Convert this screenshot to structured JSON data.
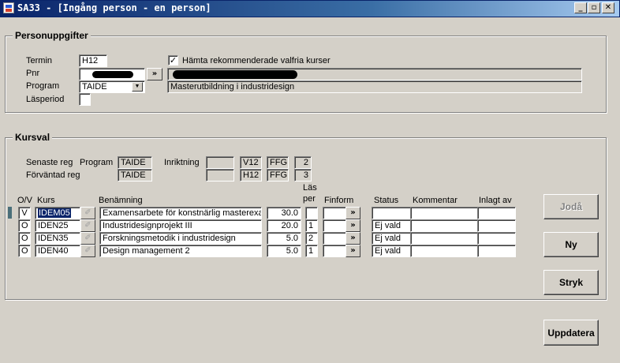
{
  "window": {
    "title": "SA33 - [Ingång person - en person]",
    "minimize_glyph": "_",
    "restore_glyph": "▫",
    "close_glyph": "✕"
  },
  "person": {
    "group_label": "Personuppgifter",
    "termin_label": "Termin",
    "termin_value": "H12",
    "pnr_label": "Pnr",
    "program_label": "Program",
    "program_value": "TAIDE",
    "lasperiod_label": "Läsperiod",
    "lasperiod_value": "",
    "checkbox_checked": true,
    "checkbox_label": "Hämta rekommenderade valfria kurser",
    "program_name": "Masterutbildning i industridesign",
    "arrow_glyph": "»"
  },
  "kursval": {
    "group_label": "Kursval",
    "senaste_label": "Senaste reg",
    "forvantad_label": "Förväntad reg",
    "program_label": "Program",
    "inriktning_label": "Inriktning",
    "senaste": {
      "program": "TAIDE",
      "inriktning": "",
      "termin": "V12",
      "typ": "FFG",
      "nr": "2"
    },
    "forvantad": {
      "program": "TAIDE",
      "inriktning": "",
      "termin": "H12",
      "typ": "FFG",
      "nr": "3"
    },
    "headers": {
      "ov": "O/V",
      "kurs": "Kurs",
      "benamning": "Benämning",
      "las": "Läs",
      "per": "per",
      "finform": "Finform",
      "status": "Status",
      "kommentar": "Kommentar",
      "inlagt": "Inlagt av"
    },
    "rows": [
      {
        "ov": "V",
        "kurs": "IDEM05",
        "benamning": "Examensarbete för konstnärlig masterexa",
        "hp": "30.0",
        "lasper": "",
        "finform": "",
        "status": "",
        "kommentar": "",
        "inlagt": ""
      },
      {
        "ov": "O",
        "kurs": "IDEN25",
        "benamning": "Industridesignprojekt III",
        "hp": "20.0",
        "lasper": "1",
        "finform": "",
        "status": "Ej vald",
        "kommentar": "",
        "inlagt": ""
      },
      {
        "ov": "O",
        "kurs": "IDEN35",
        "benamning": "Forskningsmetodik i industridesign",
        "hp": "5.0",
        "lasper": "2",
        "finform": "",
        "status": "Ej vald",
        "kommentar": "",
        "inlagt": ""
      },
      {
        "ov": "O",
        "kurs": "IDEN40",
        "benamning": "Design management 2",
        "hp": "5.0",
        "lasper": "1",
        "finform": "",
        "status": "Ej vald",
        "kommentar": "",
        "inlagt": ""
      }
    ],
    "lookup_glyph": "✐"
  },
  "buttons": {
    "joda": "Jodå",
    "ny": "Ny",
    "stryk": "Stryk",
    "uppdatera": "Uppdatera"
  }
}
